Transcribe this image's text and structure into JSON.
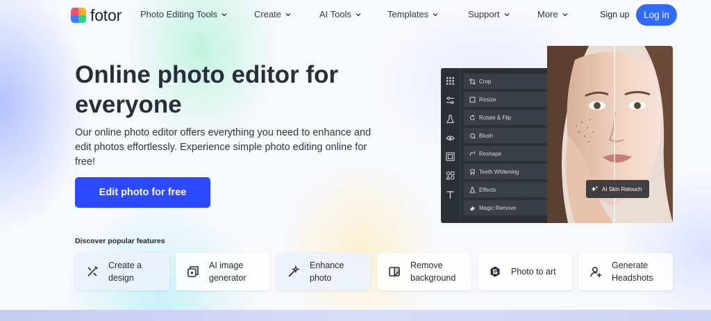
{
  "brand": {
    "name": "fotor"
  },
  "nav": {
    "items": [
      {
        "label": "Photo Editing Tools"
      },
      {
        "label": "Create"
      },
      {
        "label": "AI Tools"
      },
      {
        "label": "Templates"
      },
      {
        "label": "Support"
      },
      {
        "label": "More"
      }
    ],
    "signup": "Sign up",
    "login": "Log in"
  },
  "hero": {
    "title": "Online photo editor for everyone",
    "description": "Our online photo editor offers everything you need to enhance and edit photos effortlessly. Experience simple photo editing online for free!",
    "cta": "Edit photo for free"
  },
  "editor": {
    "tools": [
      {
        "label": "Crop",
        "icon": "crop-icon"
      },
      {
        "label": "Resize",
        "icon": "resize-icon"
      },
      {
        "label": "Rotate & Flip",
        "icon": "rotate-icon"
      },
      {
        "label": "Blush",
        "icon": "blush-icon"
      },
      {
        "label": "Reshape",
        "icon": "reshape-icon"
      },
      {
        "label": "Teeth Whitening",
        "icon": "teeth-icon"
      },
      {
        "label": "Effects",
        "icon": "effects-icon"
      },
      {
        "label": "Magic Remove",
        "icon": "eraser-icon"
      }
    ],
    "badge": "AI Skin Retouch"
  },
  "features": {
    "title": "Discover popular features",
    "items": [
      {
        "label": "Create a design",
        "icon": "design-tools-icon"
      },
      {
        "label": "AI image generator",
        "icon": "ai-image-icon"
      },
      {
        "label": "Enhance photo",
        "icon": "magic-wand-icon"
      },
      {
        "label": "Remove background",
        "icon": "remove-bg-icon"
      },
      {
        "label": "Photo to art",
        "icon": "art-logo-icon"
      },
      {
        "label": "Generate Headshots",
        "icon": "headshot-icon"
      }
    ]
  },
  "colors": {
    "primary": "#2c49ff",
    "login": "#2f6bff",
    "editor_bg": "#2b2f36",
    "text": "#2a2d3a"
  }
}
